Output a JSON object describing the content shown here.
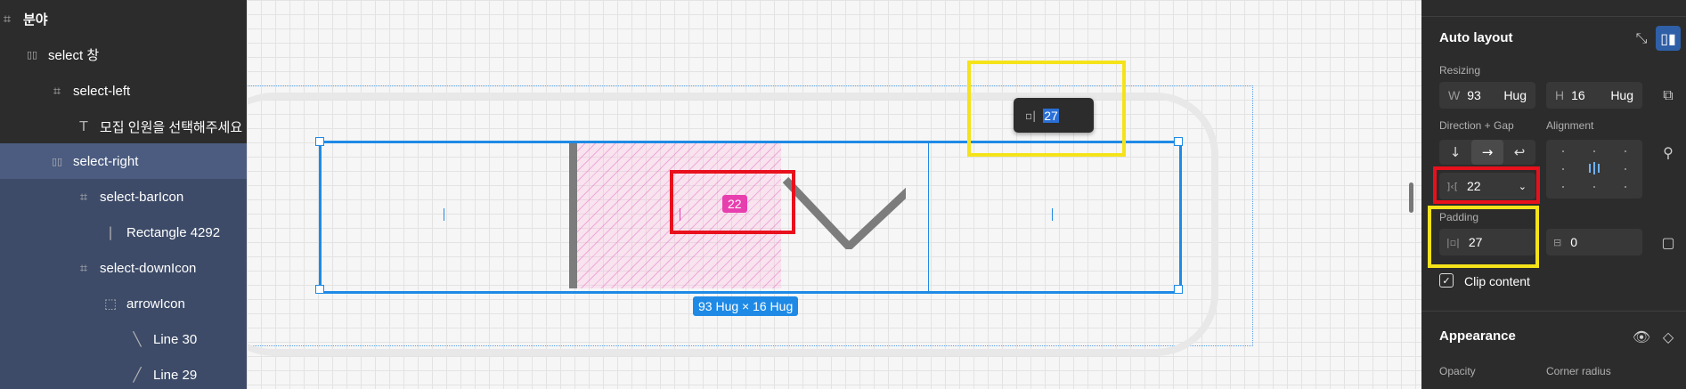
{
  "layers": [
    {
      "icon": "frame-icon",
      "glyph": "⌗",
      "label": "분야"
    },
    {
      "icon": "autolayout-icon",
      "glyph": "▯▯",
      "label": "select 창"
    },
    {
      "icon": "frame-icon",
      "glyph": "⌗",
      "label": "select-left"
    },
    {
      "icon": "text-icon",
      "glyph": "T",
      "label": "모집 인원을 선택해주세요"
    },
    {
      "icon": "autolayout-icon",
      "glyph": "▯▯",
      "label": "select-right",
      "selected": true
    },
    {
      "icon": "frame-icon",
      "glyph": "⌗",
      "label": "select-barIcon"
    },
    {
      "icon": "rectangle-icon",
      "glyph": "|",
      "label": "Rectangle 4292"
    },
    {
      "icon": "frame-icon",
      "glyph": "⌗",
      "label": "select-downIcon"
    },
    {
      "icon": "group-icon",
      "glyph": "⬚",
      "label": "arrowIcon"
    },
    {
      "icon": "line-icon",
      "glyph": "╲",
      "label": "Line 30"
    },
    {
      "icon": "line-icon",
      "glyph": "╱",
      "label": "Line 29"
    }
  ],
  "canvas": {
    "gap_badge": "22",
    "tooltip_icon": "padding-icon",
    "tooltip_value": "27",
    "size_label": "93 Hug × 16 Hug"
  },
  "props": {
    "auto_layout_title": "Auto layout",
    "resizing_label": "Resizing",
    "w_prefix": "W",
    "w_value": "93",
    "w_mode": "Hug",
    "h_prefix": "H",
    "h_value": "16",
    "h_mode": "Hug",
    "direction_gap_label": "Direction + Gap",
    "alignment_label": "Alignment",
    "gap_value": "22",
    "padding_label": "Padding",
    "padding_horizontal": "27",
    "padding_vertical": "0",
    "clip_content_label": "Clip content",
    "appearance_title": "Appearance",
    "opacity_label": "Opacity",
    "corner_radius_label": "Corner radius"
  },
  "colors": {
    "selection_blue": "#1e8ae6",
    "gap_pink": "#e83fae",
    "highlight_red": "#e8101c",
    "highlight_yellow": "#f5e31a",
    "panel_dark": "#2c2c2c"
  }
}
